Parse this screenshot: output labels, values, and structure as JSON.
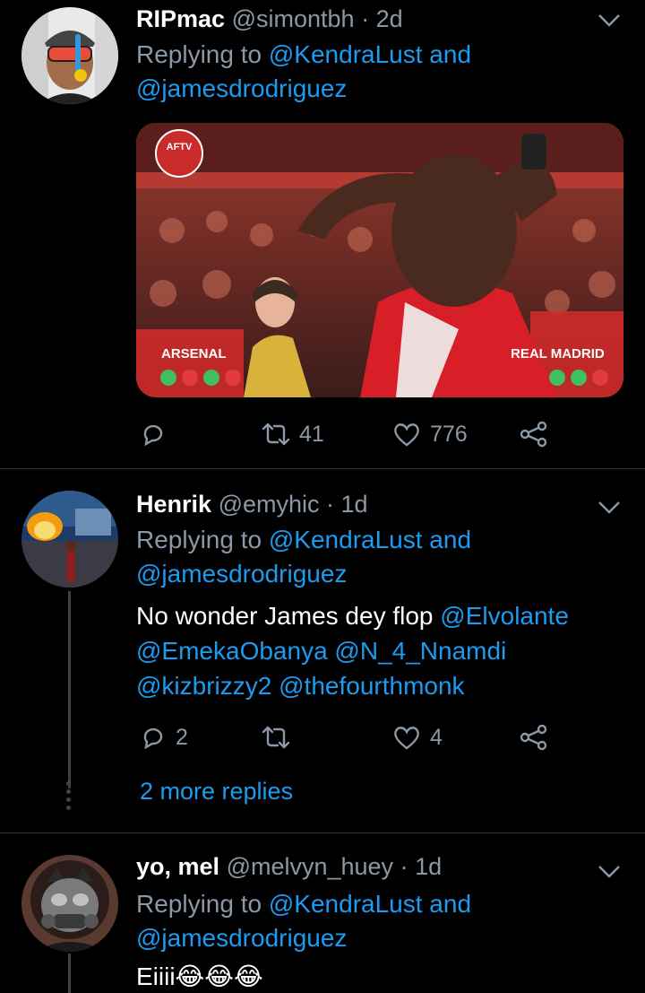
{
  "tweets": [
    {
      "name": "RIPmac",
      "handle": "@simontbh",
      "dot": "·",
      "time": "2d",
      "replying_prefix": "Replying to",
      "mention1": "@KendraLust",
      "and": "and",
      "mention2": "@jamesdrodriguez",
      "media": {
        "badge": "AFTV",
        "left_label": "ARSENAL",
        "right_label": "REAL MADRID"
      },
      "stats": {
        "replies": "",
        "retweets": "41",
        "likes": "776"
      }
    },
    {
      "name": "Henrik",
      "handle": "@emyhic",
      "dot": "·",
      "time": "1d",
      "replying_prefix": "Replying to",
      "mention1": "@KendraLust",
      "and": "and",
      "mention2": "@jamesdrodriguez",
      "text_plain": "No wonder James dey flop",
      "text_mentions": [
        "@Elvolante",
        "@EmekaObanya",
        "@N_4_Nnamdi",
        "@kizbrizzy2",
        "@thefourthmonk"
      ],
      "stats": {
        "replies": "2",
        "retweets": "",
        "likes": "4"
      },
      "more_replies": "2 more replies"
    },
    {
      "name": "yo, mel",
      "handle": "@melvyn_huey",
      "dot": "·",
      "time": "1d",
      "replying_prefix": "Replying to",
      "mention1": "@KendraLust",
      "and": "and",
      "mention2": "@jamesdrodriguez",
      "text": "Eiiii😂😂😂"
    }
  ],
  "icons": {
    "reply": "reply-icon",
    "retweet": "retweet-icon",
    "like": "heart-icon",
    "share": "share-icon",
    "more": "chevron-down-icon"
  },
  "colors": {
    "background": "#000000",
    "secondary_text": "#8b98a5",
    "link": "#1d9bf0",
    "separator": "#2f3336"
  }
}
